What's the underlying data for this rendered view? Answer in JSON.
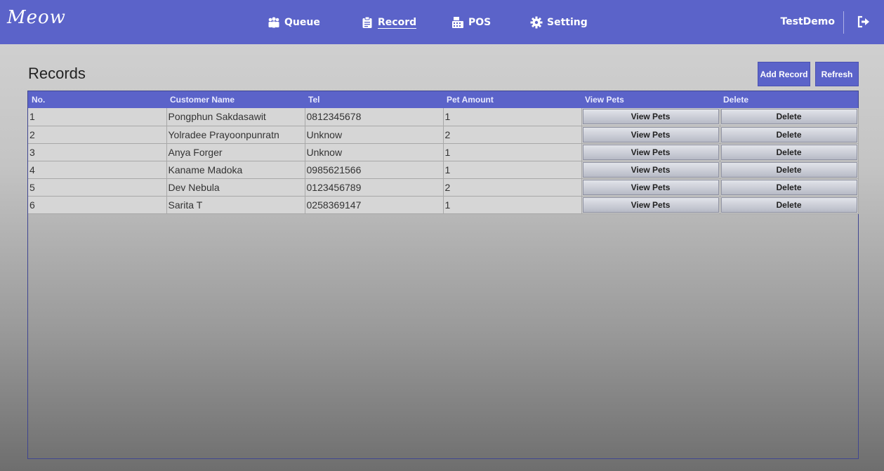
{
  "header": {
    "logo": "Meow",
    "nav": [
      {
        "label": "Queue",
        "icon": "users-icon"
      },
      {
        "label": "Record",
        "icon": "clipboard-icon",
        "active": true
      },
      {
        "label": "POS",
        "icon": "cash-register-icon"
      },
      {
        "label": "Setting",
        "icon": "gear-icon"
      }
    ],
    "username": "TestDemo",
    "logout_icon": "logout-icon"
  },
  "page": {
    "title": "Records",
    "add_record_label": "Add Record",
    "refresh_label": "Refresh"
  },
  "table": {
    "columns": [
      "No.",
      "Customer Name",
      "Tel",
      "Pet Amount",
      "View Pets",
      "Delete"
    ],
    "view_pets_label": "View Pets",
    "delete_label": "Delete",
    "rows": [
      {
        "no": "1",
        "name": "Pongphun Sakdasawit",
        "tel": "0812345678",
        "pets": "1"
      },
      {
        "no": "2",
        "name": "Yolradee Prayoonpunratn",
        "tel": "Unknow",
        "pets": "2"
      },
      {
        "no": "3",
        "name": "Anya Forger",
        "tel": "Unknow",
        "pets": "1"
      },
      {
        "no": "4",
        "name": "Kaname Madoka",
        "tel": "0985621566",
        "pets": "1"
      },
      {
        "no": "5",
        "name": "Dev Nebula",
        "tel": "0123456789",
        "pets": "2"
      },
      {
        "no": "6",
        "name": "Sarita T",
        "tel": "0258369147",
        "pets": "1"
      }
    ]
  },
  "colors": {
    "accent": "#5b63c9"
  }
}
